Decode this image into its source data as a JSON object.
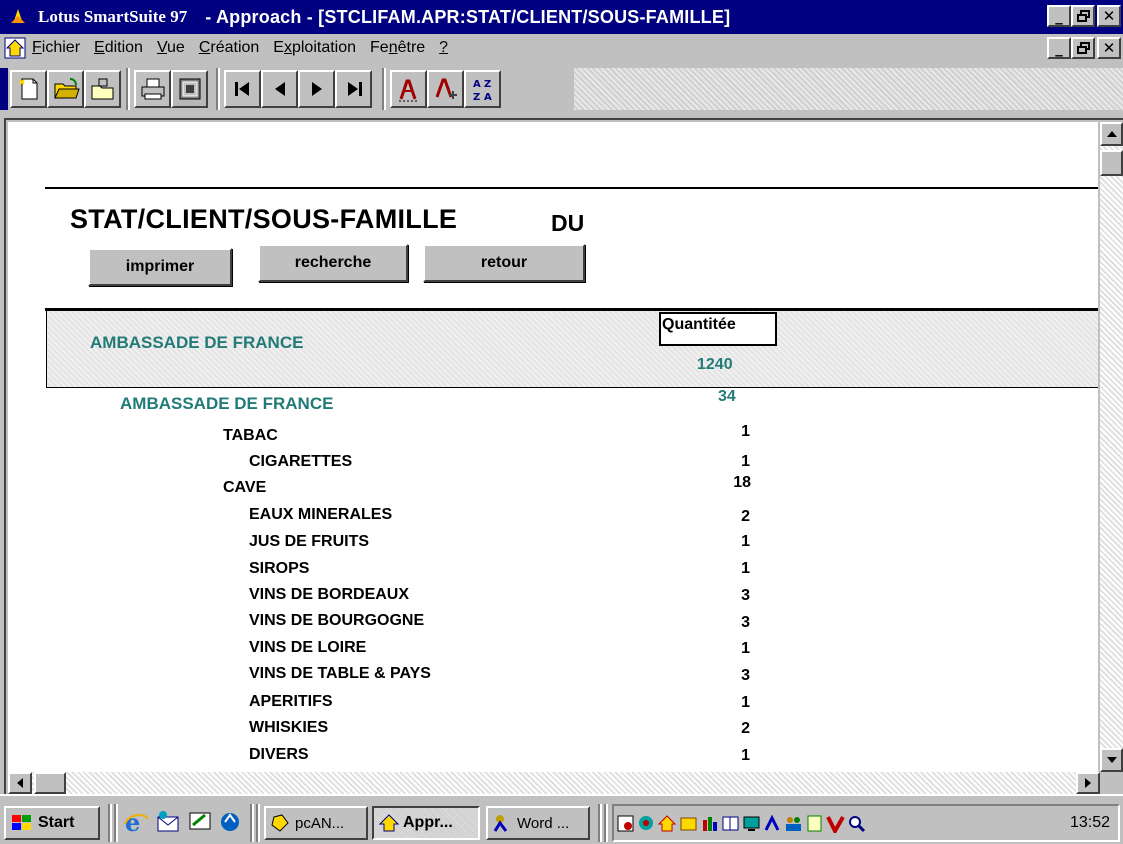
{
  "window": {
    "app_name": "Lotus SmartSuite 97",
    "doc_title": "- Approach - [STCLIFAM.APR:STAT/CLIENT/SOUS-FAMILLE]"
  },
  "menu": {
    "items": [
      {
        "label": "Fichier",
        "key": "F"
      },
      {
        "label": "Edition",
        "key": "E"
      },
      {
        "label": "Vue",
        "key": "V"
      },
      {
        "label": "Création",
        "key": "C"
      },
      {
        "label": "Exploitation",
        "key": "x"
      },
      {
        "label": "Fenêtre",
        "key": "n"
      },
      {
        "label": "?",
        "key": "?"
      }
    ]
  },
  "toolbar": {
    "icons": [
      "new-document-icon",
      "open-folder-icon",
      "save-icon",
      "print-icon",
      "preview-icon",
      "first-record-icon",
      "previous-record-icon",
      "next-record-icon",
      "last-record-icon",
      "find-icon",
      "find-all-icon",
      "sort-icon"
    ]
  },
  "report": {
    "title": "STAT/CLIENT/SOUS-FAMILLE",
    "title_suffix": "DU",
    "buttons": {
      "print": "imprimer",
      "search": "recherche",
      "back": "retour"
    },
    "column_header": "Quantitée",
    "client": {
      "name": "AMBASSADE DE FRANCE",
      "total": "1240"
    },
    "sub_client": {
      "name": "AMBASSADE DE FRANCE",
      "total": "34"
    },
    "families": [
      {
        "name": "TABAC",
        "qty": "1",
        "subs": [
          {
            "name": "CIGARETTES",
            "qty": "1"
          }
        ]
      },
      {
        "name": "CAVE",
        "qty": "18",
        "subs": [
          {
            "name": "EAUX MINERALES",
            "qty": "2"
          },
          {
            "name": "JUS DE FRUITS",
            "qty": "1"
          },
          {
            "name": "SIROPS",
            "qty": "1"
          },
          {
            "name": "VINS DE BORDEAUX",
            "qty": "3"
          },
          {
            "name": "VINS DE BOURGOGNE",
            "qty": "3"
          },
          {
            "name": "VINS DE LOIRE",
            "qty": "1"
          },
          {
            "name": "VINS DE TABLE & PAYS",
            "qty": "3"
          },
          {
            "name": "APERITIFS",
            "qty": "1"
          },
          {
            "name": "WHISKIES",
            "qty": "2"
          },
          {
            "name": "DIVERS",
            "qty": "1"
          }
        ]
      }
    ]
  },
  "taskbar": {
    "start": "Start",
    "tasks": [
      {
        "label": "pcAN...",
        "active": false
      },
      {
        "label": "Appr...",
        "active": true
      },
      {
        "label": "Word ...",
        "active": false
      }
    ],
    "clock": "13:52"
  },
  "colors": {
    "titlebar": "#000080",
    "client_text": "#227b77"
  }
}
